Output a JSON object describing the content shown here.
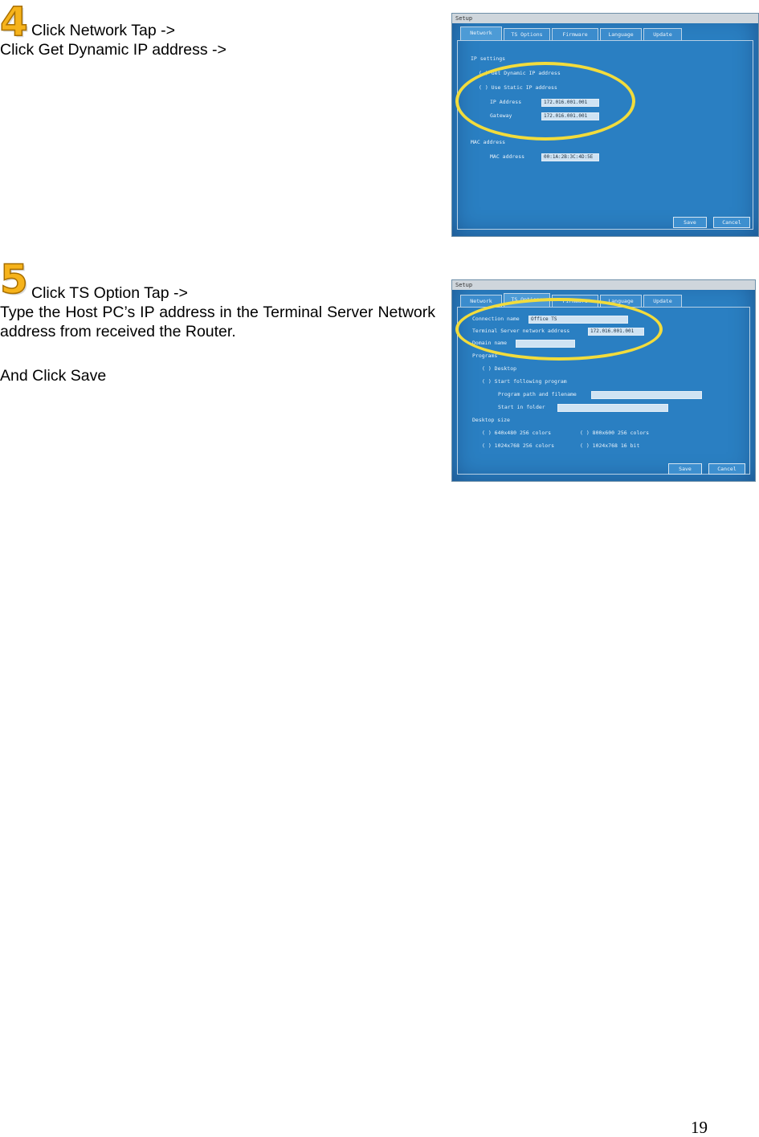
{
  "step4": {
    "number": "4",
    "line1": "Click Network Tap ->",
    "line2": "Click Get Dynamic IP address ->",
    "screen": {
      "title": "Setup",
      "tabs": [
        "Network",
        "TS Options",
        "Firmware",
        "Language",
        "Update"
      ],
      "labels": [
        "IP settings",
        "( ) Get Dynamic IP address",
        "( ) Use Static IP address",
        "IP Address",
        "Gateway",
        "MAC address",
        "MAC address"
      ],
      "ip_value": "172.016.001.001",
      "gateway_value": "172.016.001.001",
      "mac_value": "00:1A:2B:3C:4D:5E",
      "save": "Save",
      "cancel": "Cancel"
    }
  },
  "step5": {
    "number": "5",
    "line1": "Click TS Option Tap ->",
    "line2": "Type the Host PC’s IP address in the Terminal Server Network address from received the Router.",
    "line3": "And Click Save",
    "screen": {
      "title": "Setup",
      "tabs": [
        "Network",
        "TS Options",
        "Firmware",
        "Language",
        "Update"
      ],
      "labels": [
        "Connection name",
        "Terminal Server network address",
        "Domain name",
        "Programs",
        "( ) Desktop",
        "( ) Start following program",
        "Program path and filename",
        "Start in folder",
        "Desktop size",
        "( ) 640x480 256 colors",
        "( ) 800x600 256 colors",
        "( ) 1024x768 256 colors",
        "( ) 1024x768 16 bit"
      ],
      "conn_value": "Office TS",
      "ts_value": "172.016.001.001",
      "save": "Save",
      "cancel": "Cancel"
    }
  },
  "page_number": "19"
}
